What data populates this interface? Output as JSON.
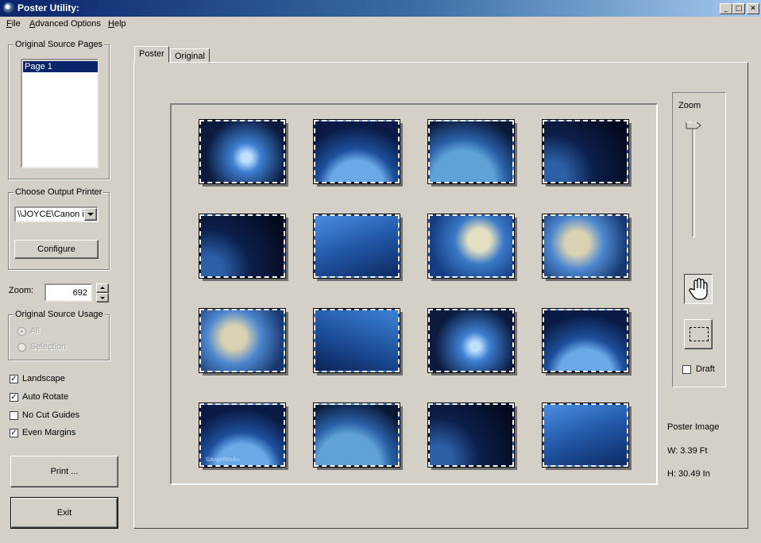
{
  "window": {
    "title": "Poster Utility:",
    "min_glyph": "_",
    "max_glyph": "□",
    "close_glyph": "✕"
  },
  "menu": {
    "file": {
      "first": "F",
      "rest": "ile"
    },
    "advanced": {
      "first": "A",
      "rest": "dvanced Options"
    },
    "help": {
      "first": "H",
      "rest": "elp"
    }
  },
  "source_pages": {
    "legend": "Original Source Pages",
    "items": [
      "Page 1"
    ],
    "selected": "Page 1"
  },
  "printer": {
    "legend": "Choose Output Printer",
    "value": "\\\\JOYCE\\Canon iP",
    "configure_label": "Configure"
  },
  "zoom": {
    "label": "Zoom:",
    "value": "692"
  },
  "usage": {
    "legend": "Original Source Usage",
    "all_label": "All",
    "selection_label": "Selection",
    "selected": "All"
  },
  "options": {
    "landscape": {
      "label": "Landscape",
      "checked": true
    },
    "auto_rotate": {
      "label": "Auto Rotate",
      "checked": true
    },
    "no_cut_guides": {
      "label": "No Cut Guides",
      "checked": false
    },
    "even_margins": {
      "label": "Even Margins",
      "checked": true
    }
  },
  "actions": {
    "print_label": "Print ...",
    "exit_label": "Exit"
  },
  "tabs": {
    "poster": "Poster",
    "original": "Original",
    "active": "Poster"
  },
  "poster_grid": {
    "rows": 4,
    "cols": 4,
    "watermark": "©AngelWorks"
  },
  "zoom_panel": {
    "label": "Zoom",
    "level": 0.05,
    "draft_label": "Draft",
    "draft_checked": false,
    "pan_tool": "hand-pan-icon",
    "select_tool": "marquee-select-icon"
  },
  "poster_info": {
    "heading": "Poster Image",
    "width": "W: 3.39 Ft",
    "height": "H: 30.49 In"
  },
  "colors": {
    "titlebar_start": "#0a246a",
    "titlebar_end": "#a6caf0",
    "face": "#d4d0c8",
    "selection": "#0a246a"
  }
}
